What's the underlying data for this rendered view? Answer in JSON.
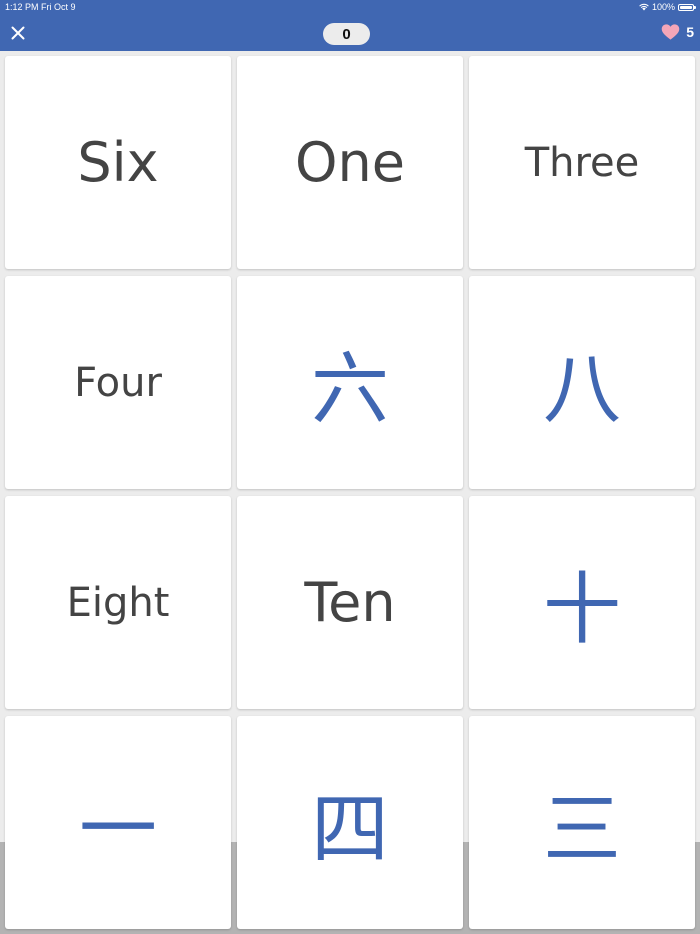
{
  "status_bar": {
    "time": "1:12 PM",
    "date": "Fri Oct 9",
    "battery": "100%"
  },
  "header": {
    "score": "0",
    "lives": "5",
    "accent_color": "#4067b2",
    "heart_color": "#f4a6b8"
  },
  "cards": [
    {
      "text": "Six",
      "kind": "word",
      "size": 54
    },
    {
      "text": "One",
      "kind": "word",
      "size": 54
    },
    {
      "text": "Three",
      "kind": "word",
      "size": 40
    },
    {
      "text": "Four",
      "kind": "word",
      "size": 40
    },
    {
      "text": "六",
      "kind": "glyph"
    },
    {
      "text": "八",
      "kind": "glyph"
    },
    {
      "text": "Eight",
      "kind": "word",
      "size": 40
    },
    {
      "text": "Ten",
      "kind": "word",
      "size": 54
    },
    {
      "text": "十",
      "kind": "glyph"
    },
    {
      "text": "一",
      "kind": "glyph"
    },
    {
      "text": "四",
      "kind": "glyph"
    },
    {
      "text": "三",
      "kind": "glyph"
    }
  ]
}
